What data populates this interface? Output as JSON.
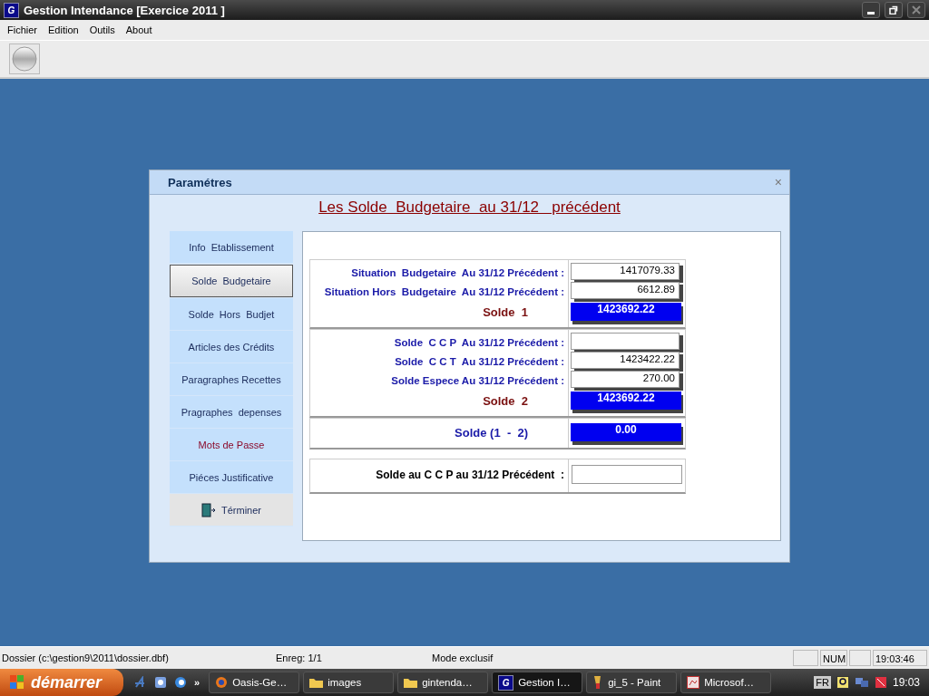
{
  "window": {
    "title": "Gestion Intendance [Exercice  2011 ]",
    "app_icon": "G"
  },
  "menu": [
    "Fichier",
    "Edition",
    "Outils",
    "About"
  ],
  "dialog": {
    "title": "Paramétres",
    "close": "×",
    "heading": "Les Solde  Budgetaire  au 31/12   précédent",
    "nav": [
      {
        "label": "Info  Etablissement",
        "selected": false,
        "kind": "normal"
      },
      {
        "label": "Solde  Budgetaire",
        "selected": true,
        "kind": "normal"
      },
      {
        "label": "Solde  Hors  Budjet",
        "selected": false,
        "kind": "normal"
      },
      {
        "label": "Articles des Crédits",
        "selected": false,
        "kind": "normal"
      },
      {
        "label": "Paragraphes Recettes",
        "selected": false,
        "kind": "normal"
      },
      {
        "label": "Pragraphes  depenses",
        "selected": false,
        "kind": "normal"
      },
      {
        "label": "Mots de Passe",
        "selected": false,
        "kind": "warning"
      },
      {
        "label": "Piéces Justificative",
        "selected": false,
        "kind": "normal"
      },
      {
        "label": "Términer",
        "selected": false,
        "kind": "exit"
      }
    ],
    "groups": [
      {
        "rows": [
          {
            "kind": "field",
            "label": "Situation  Budgetaire  Au 31/12 Précédent :",
            "value": "1417079.33"
          },
          {
            "kind": "field",
            "label": "Situation Hors  Budgetaire  Au 31/12 Précédent :",
            "value": "6612.89"
          },
          {
            "kind": "total",
            "label": "Solde  1",
            "value": "1423692.22"
          }
        ]
      },
      {
        "rows": [
          {
            "kind": "field",
            "label": "Solde  C C P  Au 31/12 Précédent :"
          },
          {
            "kind": "field",
            "label": "Solde  C C T  Au 31/12 Précédent :",
            "value": "1423422.22"
          },
          {
            "kind": "field",
            "label": "Solde Espece Au 31/12 Précédent :",
            "value": "270.00"
          },
          {
            "kind": "total",
            "label": "Solde  2",
            "value": "1423692.22"
          }
        ]
      },
      {
        "rows": [
          {
            "kind": "difference",
            "label": "Solde (1  -  2)",
            "value": "0.00"
          }
        ]
      }
    ],
    "ccp_row": {
      "label": "Solde au C C P au 31/12 Précédent  :"
    }
  },
  "status_bar": {
    "path": "Dossier (c:\\gestion9\\2011\\dossier.dbf)",
    "record": "Enreg: 1/1",
    "mode": "Mode exclusif",
    "num_lock": "NUM",
    "time": "19:03:46"
  },
  "taskbar": {
    "start": "démarrer",
    "more": "»",
    "tasks": [
      {
        "label": "Oasis-Ge…",
        "kind": "browser",
        "selected": false
      },
      {
        "label": "images",
        "kind": "folder",
        "selected": false
      },
      {
        "label": "gintenda…",
        "kind": "folder",
        "selected": false
      },
      {
        "label": "Gestion I…",
        "kind": "app",
        "selected": true,
        "icon_letter": "G"
      },
      {
        "label": "gi_5 - Paint",
        "kind": "paint",
        "selected": false
      },
      {
        "label": "Microsof…",
        "kind": "doc",
        "selected": false
      }
    ],
    "language": "FR",
    "clock": "19:03"
  }
}
